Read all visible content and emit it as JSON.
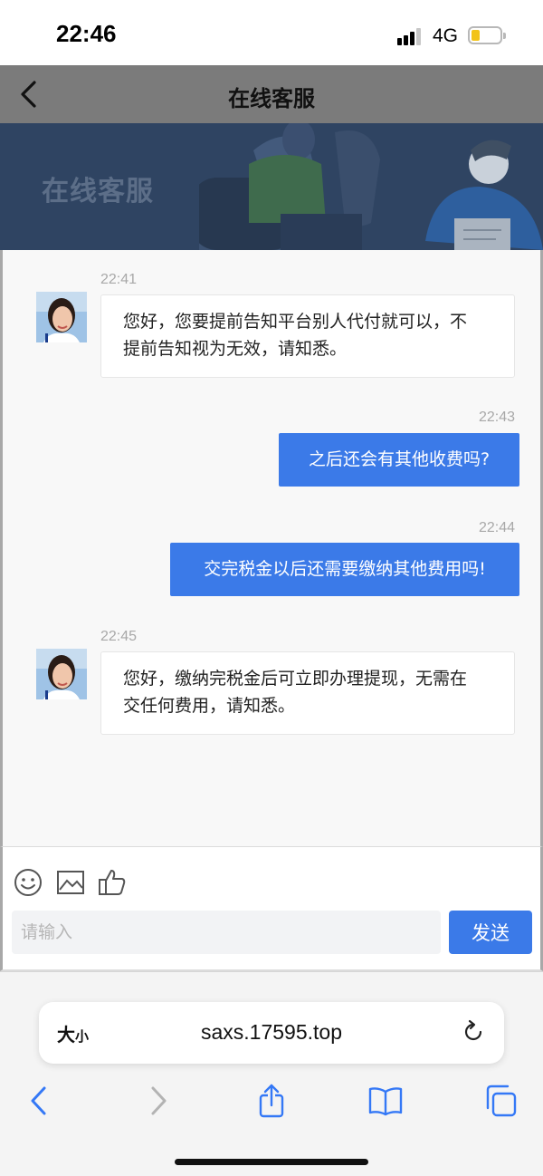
{
  "status_bar": {
    "time": "22:46",
    "network": "4G",
    "battery_color": "#f2c318"
  },
  "header": {
    "title": "在线客服",
    "back_icon": "chevron-left-icon"
  },
  "banner": {
    "title": "在线客服"
  },
  "messages": [
    {
      "direction": "incoming",
      "time": "22:41",
      "lines": [
        "您好，您要提前告知平台别人代付就可以，不",
        "提前告知视为无效，请知悉。"
      ]
    },
    {
      "direction": "outgoing",
      "time": "22:43",
      "text": "之后还会有其他收费吗?"
    },
    {
      "direction": "outgoing",
      "time": "22:44",
      "text": "交完税金以后还需要缴纳其他费用吗!"
    },
    {
      "direction": "incoming",
      "time": "22:45",
      "lines": [
        "您好，缴纳完税金后可立即办理提现，无需在",
        "交任何费用，请知悉。"
      ]
    }
  ],
  "input_panel": {
    "tools": [
      "emoji-icon",
      "image-icon",
      "thumbs-up-icon"
    ],
    "placeholder": "请输入",
    "value": "",
    "send_label": "发送"
  },
  "safari": {
    "text_size_big": "大",
    "text_size_small": "小",
    "url": "saxs.17595.top",
    "toolbar_icons": [
      "back-icon",
      "forward-icon",
      "share-icon",
      "bookmarks-icon",
      "tabs-icon"
    ]
  },
  "colors": {
    "accent": "#3b7ae8",
    "header_bg": "#7b7b7b",
    "banner_bg": "#2f4462"
  }
}
